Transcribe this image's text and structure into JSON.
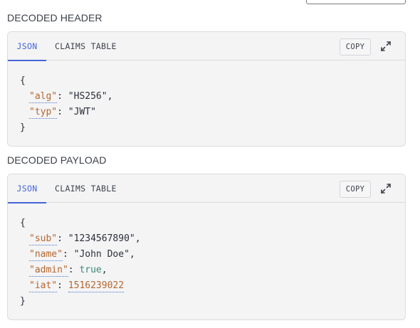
{
  "header_section": {
    "title": "DECODED HEADER",
    "tabs": {
      "json": "JSON",
      "claims": "CLAIMS TABLE"
    },
    "copy_label": "COPY",
    "json": {
      "open": "{",
      "close": "}",
      "alg_key": "\"alg\"",
      "alg_value": "\"HS256\"",
      "typ_key": "\"typ\"",
      "typ_value": "\"JWT\""
    }
  },
  "payload_section": {
    "title": "DECODED PAYLOAD",
    "tabs": {
      "json": "JSON",
      "claims": "CLAIMS TABLE"
    },
    "copy_label": "COPY",
    "json": {
      "open": "{",
      "close": "}",
      "sub_key": "\"sub\"",
      "sub_value": "\"1234567890\"",
      "name_key": "\"name\"",
      "name_value": "\"John Doe\"",
      "admin_key": "\"admin\"",
      "admin_value": "true",
      "iat_key": "\"iat\"",
      "iat_value": "1516239022"
    }
  },
  "icons": {
    "expand": "expand-arrows-icon"
  },
  "colors": {
    "active_tab": "#4466d6",
    "key": "#b5662e",
    "bool": "#3a8a78",
    "panel_bg": "#f4f4f5"
  }
}
